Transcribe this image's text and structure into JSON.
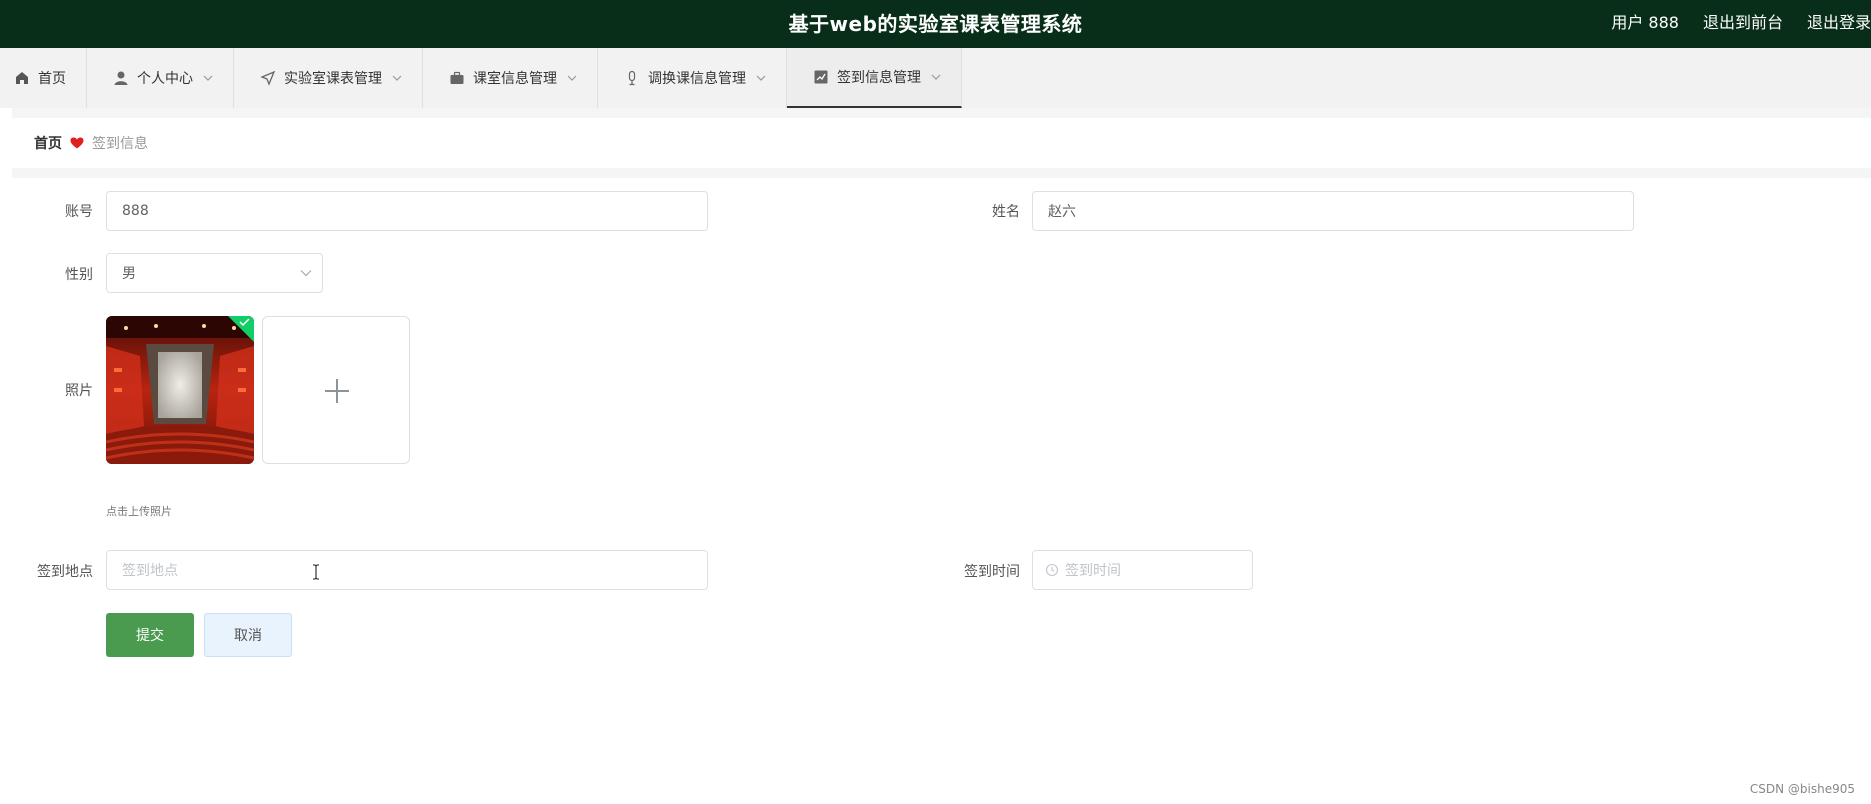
{
  "header": {
    "title": "基于web的实验室课表管理系统",
    "user": "用户 888",
    "back_front": "退出到前台",
    "logout": "退出登录",
    "bg_color": "#082d18"
  },
  "nav": {
    "items": [
      {
        "label": "首页",
        "icon": "home-icon"
      },
      {
        "label": "个人中心",
        "icon": "user-icon"
      },
      {
        "label": "实验室课表管理",
        "icon": "send-icon"
      },
      {
        "label": "课室信息管理",
        "icon": "briefcase-icon"
      },
      {
        "label": "调换课信息管理",
        "icon": "microphone-icon"
      },
      {
        "label": "签到信息管理",
        "icon": "chart-icon"
      }
    ],
    "active_index": 5
  },
  "breadcrumb": {
    "home": "首页",
    "current": "签到信息"
  },
  "form": {
    "account_label": "账号",
    "account_value": "888",
    "name_label": "姓名",
    "name_value": "赵六",
    "gender_label": "性别",
    "gender_value": "男",
    "photo_label": "照片",
    "photo_hint": "点击上传照片",
    "location_label": "签到地点",
    "location_placeholder": "签到地点",
    "time_label": "签到时间",
    "time_placeholder": "签到时间",
    "submit": "提交",
    "cancel": "取消",
    "accent": "#4a9b50"
  },
  "watermark": "CSDN @bishe905"
}
